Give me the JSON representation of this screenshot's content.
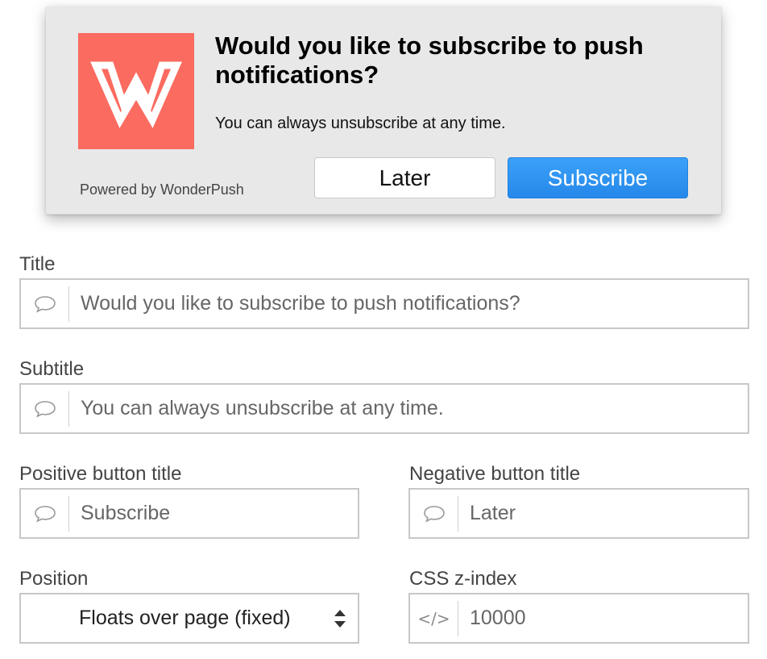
{
  "prompt": {
    "logo_icon": "wonderpush-w-logo",
    "logo_color": "#fb6b60",
    "title": "Would you like to subscribe to push notifications?",
    "subtitle": "You can always unsubscribe at any time.",
    "powered_by": "Powered by WonderPush",
    "negative_button": "Later",
    "positive_button": "Subscribe",
    "positive_color": "#2f93f2"
  },
  "form": {
    "title": {
      "label": "Title",
      "icon": "speech-bubble-icon",
      "value": "Would you like to subscribe to push notifications?"
    },
    "subtitle": {
      "label": "Subtitle",
      "icon": "speech-bubble-icon",
      "value": "You can always unsubscribe at any time."
    },
    "positive": {
      "label": "Positive button title",
      "icon": "speech-bubble-icon",
      "value": "Subscribe"
    },
    "negative": {
      "label": "Negative button title",
      "icon": "speech-bubble-icon",
      "value": "Later"
    },
    "position": {
      "label": "Position",
      "selected": "Floats over page (fixed)",
      "icon": "up-down-arrows-icon"
    },
    "zindex": {
      "label": "CSS z-index",
      "icon": "code-icon",
      "icon_text": "</>",
      "value": "10000"
    }
  }
}
